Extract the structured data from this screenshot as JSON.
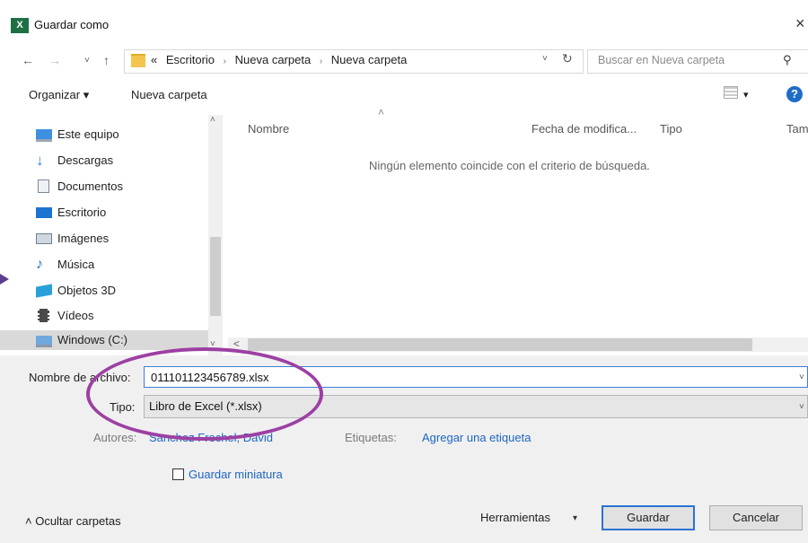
{
  "window": {
    "title": "Guardar como",
    "app_icon_text": "X",
    "close_glyph": "×"
  },
  "nav": {
    "back_glyph": "←",
    "forward_glyph": "→",
    "recent_glyph": "˅",
    "up_glyph": "↑",
    "breadcrumb_prefix": "«",
    "breadcrumb": [
      "Escritorio",
      "Nueva carpeta",
      "Nueva carpeta"
    ],
    "breadcrumb_sep": "›",
    "refresh_glyph": "↻",
    "search_placeholder": "Buscar en Nueva carpeta",
    "search_icon_glyph": "⚲"
  },
  "toolbar": {
    "organize_label": "Organizar ▾",
    "new_folder_label": "Nueva carpeta",
    "view_dd": "▾",
    "help_glyph": "?"
  },
  "nav_pane": {
    "items": [
      {
        "label": "Este equipo",
        "icon": "computer-icon",
        "color": "#3d8fe0"
      },
      {
        "label": "Descargas",
        "icon": "download-arrow-icon",
        "color": "#2f7bd6"
      },
      {
        "label": "Documentos",
        "icon": "document-icon",
        "color": "#7a8a99"
      },
      {
        "label": "Escritorio",
        "icon": "desktop-icon",
        "color": "#1c74d1"
      },
      {
        "label": "Imágenes",
        "icon": "image-icon",
        "color": "#6f7f8f"
      },
      {
        "label": "Música",
        "icon": "music-note-icon",
        "color": "#1c74d1"
      },
      {
        "label": "Objetos 3D",
        "icon": "cube-3d-icon",
        "color": "#2aa0d8"
      },
      {
        "label": "Vídeos",
        "icon": "film-icon",
        "color": "#4a4a4a"
      },
      {
        "label": "Windows (C:)",
        "icon": "drive-icon",
        "color": "#6fa8dc"
      }
    ],
    "selected_index": 8,
    "scroll_up_glyph": "˄",
    "scroll_down_glyph": "˅"
  },
  "file_list": {
    "columns": [
      "Nombre",
      "Fecha de modifica...",
      "Tipo",
      "Tam"
    ],
    "sort_glyph": "˄",
    "empty_message": "Ningún elemento coincide con el criterio de búsqueda.",
    "hscroll_left_glyph": "<"
  },
  "form": {
    "filename_label": "Nombre de archivo:",
    "filename_value": "011101123456789.xlsx",
    "type_label": "Tipo:",
    "type_value": "Libro de Excel (*.xlsx)",
    "authors_label": "Autores:",
    "authors_value": "Sanchez Frechel, David",
    "tags_label": "Etiquetas:",
    "tags_value": "Agregar una etiqueta",
    "thumbnail_label": "Guardar miniatura",
    "dropdown_glyph": "˅"
  },
  "footer": {
    "hide_folders_label": "˄  Ocultar carpetas",
    "tools_label": "Herramientas",
    "tools_dd": "▾",
    "save_label": "Guardar",
    "cancel_label": "Cancelar"
  },
  "annotation": {
    "ellipse_color": "#9c40a3"
  }
}
